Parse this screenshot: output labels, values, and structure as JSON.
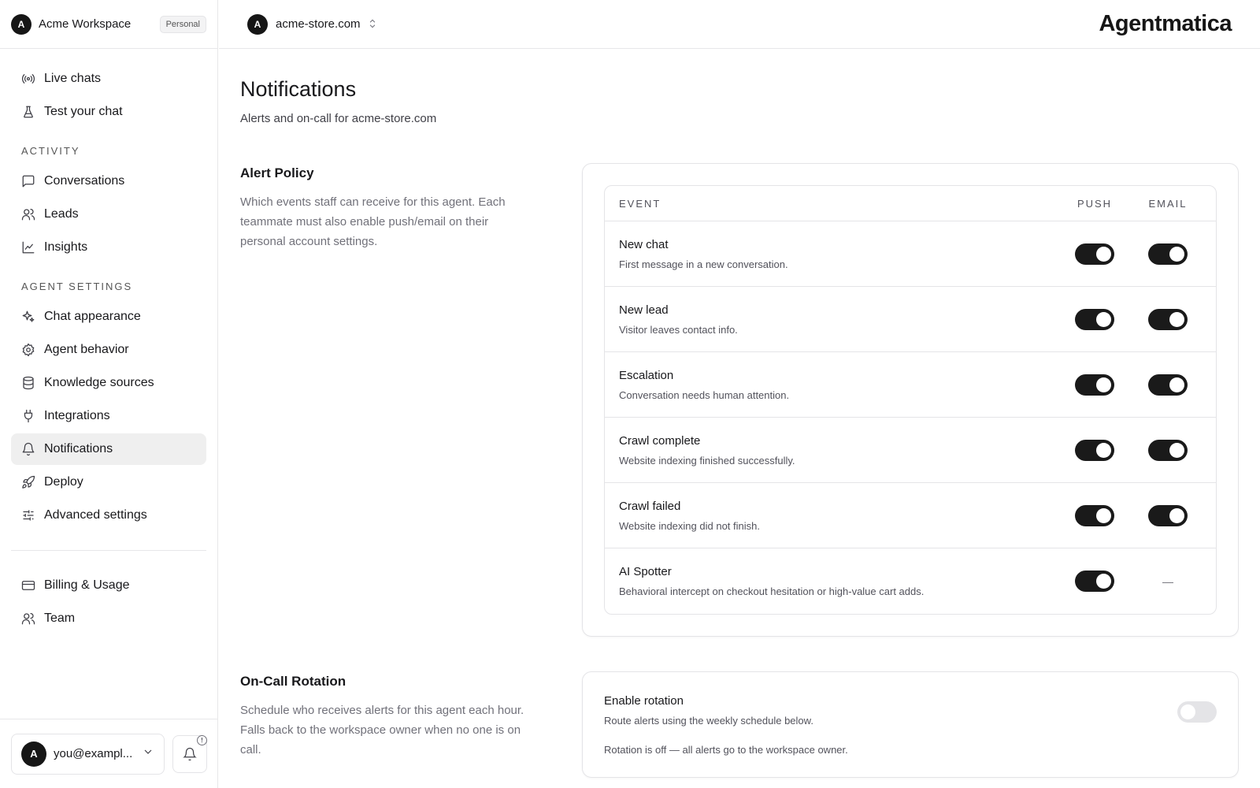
{
  "workspace": {
    "avatar": "A",
    "name": "Acme Workspace",
    "badge": "Personal"
  },
  "site": {
    "avatar": "A",
    "name": "acme-store.com"
  },
  "brand": "Agentmatica",
  "nav": {
    "top": [
      {
        "label": "Live chats",
        "icon": "broadcast-icon"
      },
      {
        "label": "Test your chat",
        "icon": "flask-icon"
      }
    ],
    "activity_heading": "ACTIVITY",
    "activity": [
      {
        "label": "Conversations",
        "icon": "message-square-icon"
      },
      {
        "label": "Leads",
        "icon": "users-icon"
      },
      {
        "label": "Insights",
        "icon": "line-chart-icon"
      }
    ],
    "agent_heading": "AGENT SETTINGS",
    "agent": [
      {
        "label": "Chat appearance",
        "icon": "sparkles-icon"
      },
      {
        "label": "Agent behavior",
        "icon": "gear-icon"
      },
      {
        "label": "Knowledge sources",
        "icon": "database-icon"
      },
      {
        "label": "Integrations",
        "icon": "plug-icon"
      },
      {
        "label": "Notifications",
        "icon": "bell-icon",
        "active": true
      },
      {
        "label": "Deploy",
        "icon": "rocket-icon"
      },
      {
        "label": "Advanced settings",
        "icon": "sliders-icon"
      }
    ],
    "bottom": [
      {
        "label": "Billing & Usage",
        "icon": "credit-card-icon"
      },
      {
        "label": "Team",
        "icon": "users-icon"
      }
    ]
  },
  "user": {
    "avatar": "A",
    "email": "you@exampl..."
  },
  "page": {
    "title": "Notifications",
    "subtitle": "Alerts and on-call for acme-store.com"
  },
  "alert_policy": {
    "title": "Alert Policy",
    "description": "Which events staff can receive for this agent. Each teammate must also enable push/email on their personal account settings.",
    "columns": {
      "event": "EVENT",
      "push": "PUSH",
      "email": "EMAIL"
    },
    "rows": [
      {
        "name": "New chat",
        "desc": "First message in a new conversation.",
        "push": true,
        "email": true
      },
      {
        "name": "New lead",
        "desc": "Visitor leaves contact info.",
        "push": true,
        "email": true
      },
      {
        "name": "Escalation",
        "desc": "Conversation needs human attention.",
        "push": true,
        "email": true
      },
      {
        "name": "Crawl complete",
        "desc": "Website indexing finished successfully.",
        "push": true,
        "email": true
      },
      {
        "name": "Crawl failed",
        "desc": "Website indexing did not finish.",
        "push": true,
        "email": true
      },
      {
        "name": "AI Spotter",
        "desc": "Behavioral intercept on checkout hesitation or high-value cart adds.",
        "push": true,
        "email": null
      }
    ],
    "email_unavailable": "—"
  },
  "on_call": {
    "title": "On-Call Rotation",
    "description": "Schedule who receives alerts for this agent each hour. Falls back to the workspace owner when no one is on call.",
    "enable_title": "Enable rotation",
    "enable_desc": "Route alerts using the weekly schedule below.",
    "enabled": false,
    "note": "Rotation is off — all alerts go to the workspace owner."
  }
}
